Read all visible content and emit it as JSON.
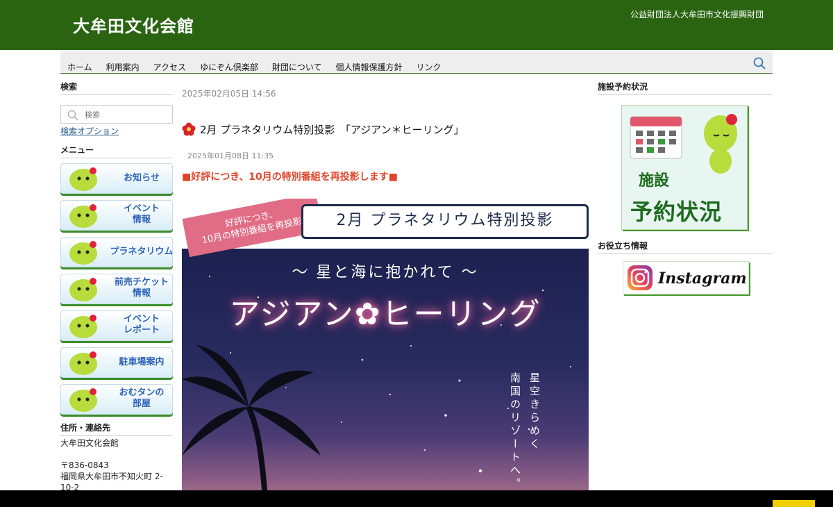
{
  "header": {
    "title": "大牟田文化会館",
    "org": "公益財団法人大牟田市文化振興財団"
  },
  "nav": {
    "items": [
      "ホーム",
      "利用案内",
      "アクセス",
      "ゆにぞん倶楽部",
      "財団について",
      "個人情報保護方針",
      "リンク"
    ]
  },
  "left": {
    "search_title": "検索",
    "search_placeholder": "検索",
    "search_options": "検索オプション",
    "menu_title": "メニュー",
    "menu": [
      "お知らせ",
      "イベント 情報",
      "プラネタリウム",
      "前売チケット 情報",
      "イベント レポート",
      "駐車場案内",
      "おむタンの 部屋"
    ],
    "address_title": "住所・連絡先",
    "address_lines": [
      "大牟田文化会館",
      "",
      "〒836-0843",
      "福岡県大牟田市不知火町 2-",
      "10-2"
    ]
  },
  "main": {
    "post_date": "2025年02月05日 14:56",
    "article_title": "2月 プラネタリウム特別投影　「アジアン＊ヒーリング」",
    "article_date": "2025年01月08日 11:35",
    "highlight": "■好評につき、10月の特別番組を再投影します■",
    "poster": {
      "ribbon_line1": "好評につき、",
      "ribbon_line2": "10月の特別番組を再投影!",
      "box_title": "2月 プラネタリウム特別投影",
      "subtitle": "〜 星と海に抱かれて 〜",
      "main_title": "アジアン✿ヒーリング",
      "vertical_1": "星空きらめく",
      "vertical_2": "南国のリゾートへ。"
    }
  },
  "right": {
    "reservation_title": "施設予約状況",
    "reservation_card_line1": "施設",
    "reservation_card_line2": "予約状況",
    "info_title": "お役立ち情報",
    "instagram_label": "Instagram"
  },
  "colors": {
    "header_green": "#2a6411",
    "highlight_red": "#e0452a",
    "menu_text_blue": "#2a63b8"
  }
}
